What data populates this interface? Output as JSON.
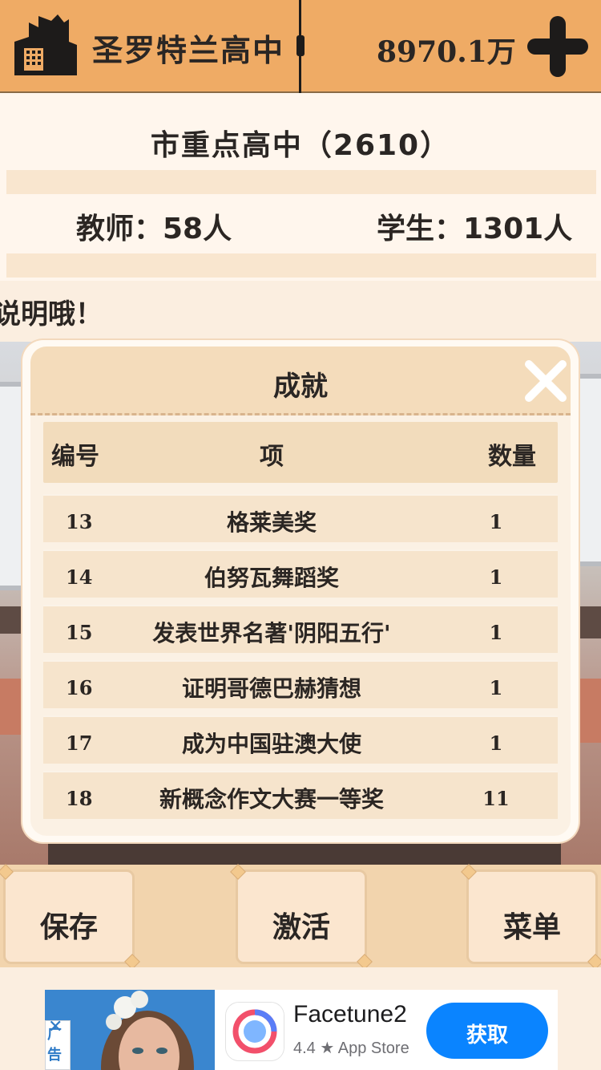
{
  "topbar": {
    "school_name": "圣罗特兰高中",
    "money": "8970.1万"
  },
  "school_info": {
    "level": "市重点高中（2610）",
    "teachers": "教师：58人",
    "students": "学生：1301人",
    "hint": "说明哦！"
  },
  "achievements": {
    "title": "成就",
    "columns": [
      "编号",
      "项",
      "数量"
    ],
    "rows": [
      {
        "id": "13",
        "item": "格莱美奖",
        "count": "1"
      },
      {
        "id": "14",
        "item": "伯努瓦舞蹈奖",
        "count": "1"
      },
      {
        "id": "15",
        "item": "发表世界名著'阴阳五行'",
        "count": "1"
      },
      {
        "id": "16",
        "item": "证明哥德巴赫猜想",
        "count": "1"
      },
      {
        "id": "17",
        "item": "成为中国驻澳大使",
        "count": "1"
      },
      {
        "id": "18",
        "item": "新概念作文大赛一等奖",
        "count": "11"
      }
    ]
  },
  "buttons": {
    "save": "保存",
    "activate": "激活",
    "menu": "菜单"
  },
  "ad": {
    "badge": "广告",
    "close": "✕",
    "app_name": "Facetune2",
    "rating": "4.4 ★ App Store",
    "cta": "获取"
  },
  "colors": {
    "topbar": "#efab65",
    "panel": "#fff6ed",
    "modal_header": "#f4dcbb",
    "row": "#f6e4cc",
    "cta": "#0a84ff"
  }
}
